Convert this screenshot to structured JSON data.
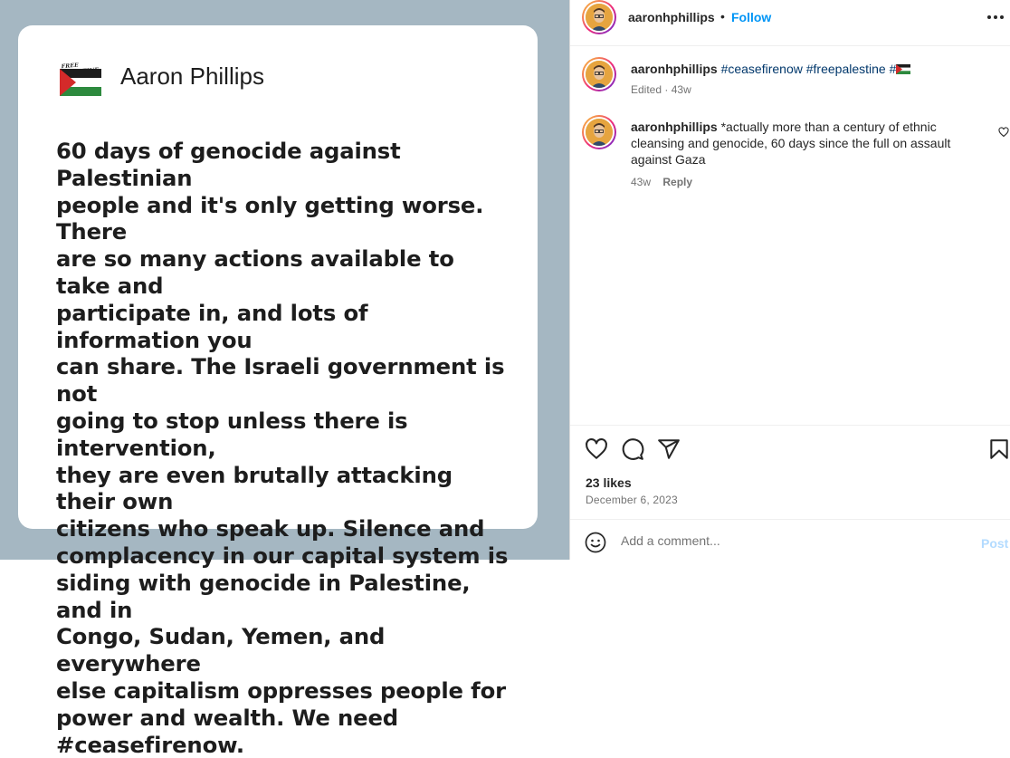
{
  "media": {
    "card": {
      "flag_caption": "FREE PALESTINE",
      "name": "Aaron Phillips",
      "body": "60 days of genocide against Palestinian\npeople and it's only getting worse. There\nare so many actions available to take and\nparticipate in, and lots of information you\ncan share. The Israeli government is not\ngoing to stop unless there is intervention,\nthey are even brutally attacking their own\ncitizens who speak up. Silence and\ncomplacency in our capital system is\nsiding with genocide in Palestine, and in\nCongo, Sudan, Yemen, and everywhere\nelse capitalism oppresses people for\npower and wealth. We need #ceasefirenow."
    }
  },
  "header": {
    "username": "aaronhphillips",
    "separator": "•",
    "follow_label": "Follow"
  },
  "caption": {
    "username": "aaronhphillips",
    "hashtags": [
      "#ceasefirenow",
      "#freepalestine",
      "#"
    ],
    "edited_label": "Edited",
    "dot": "·",
    "time": "43w"
  },
  "comment": {
    "username": "aaronhphillips",
    "text": "*actually more than a century of ethnic cleansing and genocide, 60 days since the full on assault against Gaza",
    "time": "43w",
    "reply_label": "Reply"
  },
  "stats": {
    "likes": "23 likes",
    "date": "December 6, 2023"
  },
  "comment_box": {
    "placeholder": "Add a comment...",
    "post_label": "Post"
  },
  "colors": {
    "media_background": "#a5b7c2",
    "follow_blue": "#0095f6",
    "hashtag_blue": "#00376b",
    "post_disabled": "#b3dbff"
  },
  "icons": [
    "heart-icon",
    "comment-icon",
    "share-icon",
    "bookmark-icon",
    "emoji-icon",
    "more-options-icon",
    "palestine-flag-icon"
  ]
}
